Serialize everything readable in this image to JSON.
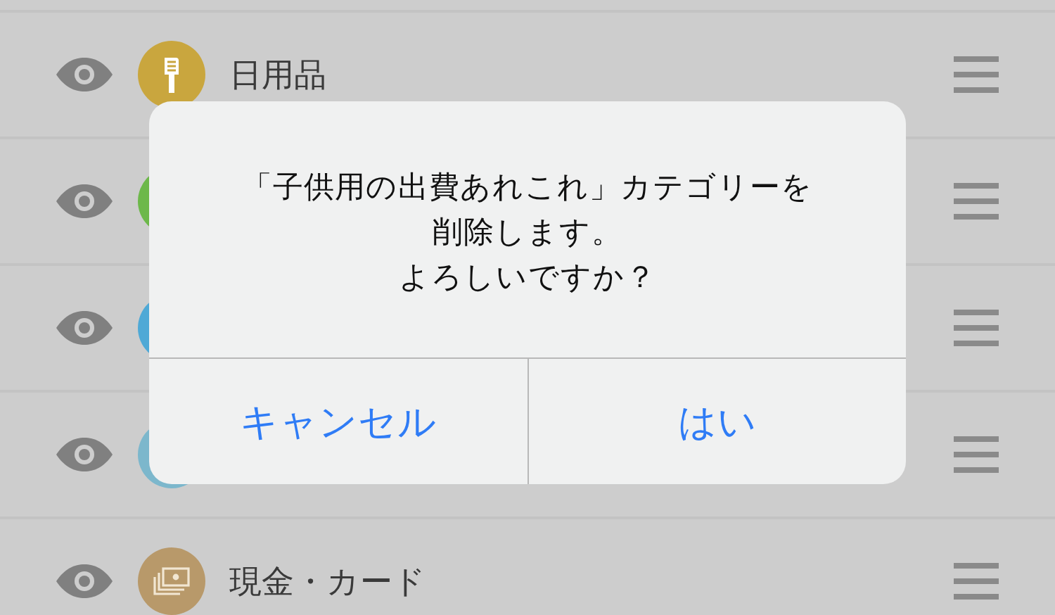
{
  "categories": [
    {
      "label": "日用品",
      "color": "#c9a63e"
    },
    {
      "color": "#6db84a"
    },
    {
      "color": "#4fa9d6"
    },
    {
      "color": "#7cb7cc"
    },
    {
      "label": "現金・カード",
      "color": "#b8996a"
    }
  ],
  "alert": {
    "message": [
      "「子供用の出費あれこれ」カテゴリーを削除します。",
      "よろしいですか？"
    ],
    "buttons": [
      "キャンセル",
      "はい"
    ]
  }
}
